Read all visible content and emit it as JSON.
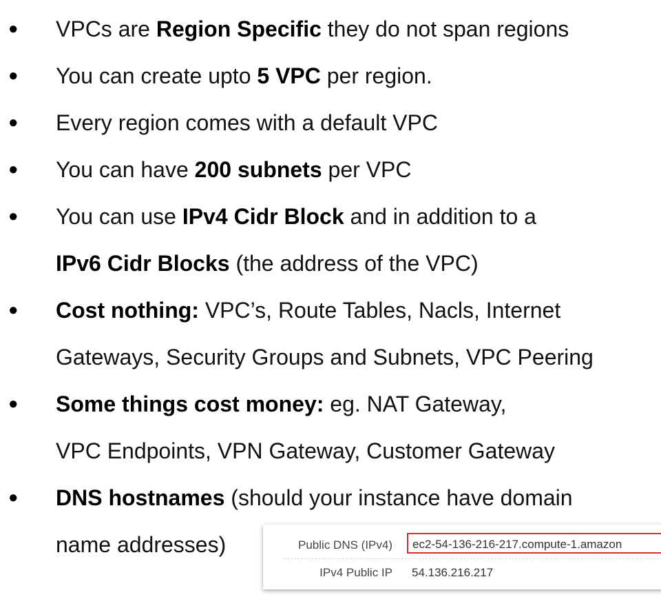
{
  "bullets": [
    {
      "lines": [
        [
          {
            "text": "VPCs are ",
            "bold": false
          },
          {
            "text": "Region Specific",
            "bold": true
          },
          {
            "text": " they do not span regions",
            "bold": false
          }
        ]
      ]
    },
    {
      "lines": [
        [
          {
            "text": "You can create upto ",
            "bold": false
          },
          {
            "text": "5 VPC",
            "bold": true
          },
          {
            "text": " per region.",
            "bold": false
          }
        ]
      ]
    },
    {
      "lines": [
        [
          {
            "text": "Every region comes with a default VPC",
            "bold": false
          }
        ]
      ]
    },
    {
      "lines": [
        [
          {
            "text": "You can have ",
            "bold": false
          },
          {
            "text": "200 subnets",
            "bold": true
          },
          {
            "text": " per VPC",
            "bold": false
          }
        ]
      ]
    },
    {
      "lines": [
        [
          {
            "text": "You can use ",
            "bold": false
          },
          {
            "text": "IPv4 Cidr Block",
            "bold": true
          },
          {
            "text": " and in addition to a",
            "bold": false
          }
        ],
        [
          {
            "text": "IPv6 Cidr Blocks",
            "bold": true
          },
          {
            "text": " (the address of the VPC)",
            "bold": false
          }
        ]
      ]
    },
    {
      "lines": [
        [
          {
            "text": "Cost nothing:",
            "bold": true
          },
          {
            "text": " VPC’s, Route Tables, Nacls, Internet",
            "bold": false
          }
        ],
        [
          {
            "text": "Gateways, Security Groups and Subnets, VPC Peering",
            "bold": false
          }
        ]
      ]
    },
    {
      "lines": [
        [
          {
            "text": "Some things cost money:",
            "bold": true
          },
          {
            "text": " eg. NAT Gateway,",
            "bold": false
          }
        ],
        [
          {
            "text": "VPC Endpoints, VPN Gateway, Customer Gateway",
            "bold": false
          }
        ]
      ]
    },
    {
      "lines": [
        [
          {
            "text": "DNS hostnames",
            "bold": true
          },
          {
            "text": " (should your instance have domain",
            "bold": false
          }
        ],
        [
          {
            "text": "name addresses)",
            "bold": false
          }
        ]
      ]
    }
  ],
  "bullet_glyph": "●",
  "dns_panel": {
    "rows": [
      {
        "label": "Public DNS (IPv4)",
        "value": "ec2-54-136-216-217.compute-1.amazon"
      },
      {
        "label": "IPv4 Public IP",
        "value": "54.136.216.217"
      }
    ],
    "highlight_color": "#d0302a"
  }
}
